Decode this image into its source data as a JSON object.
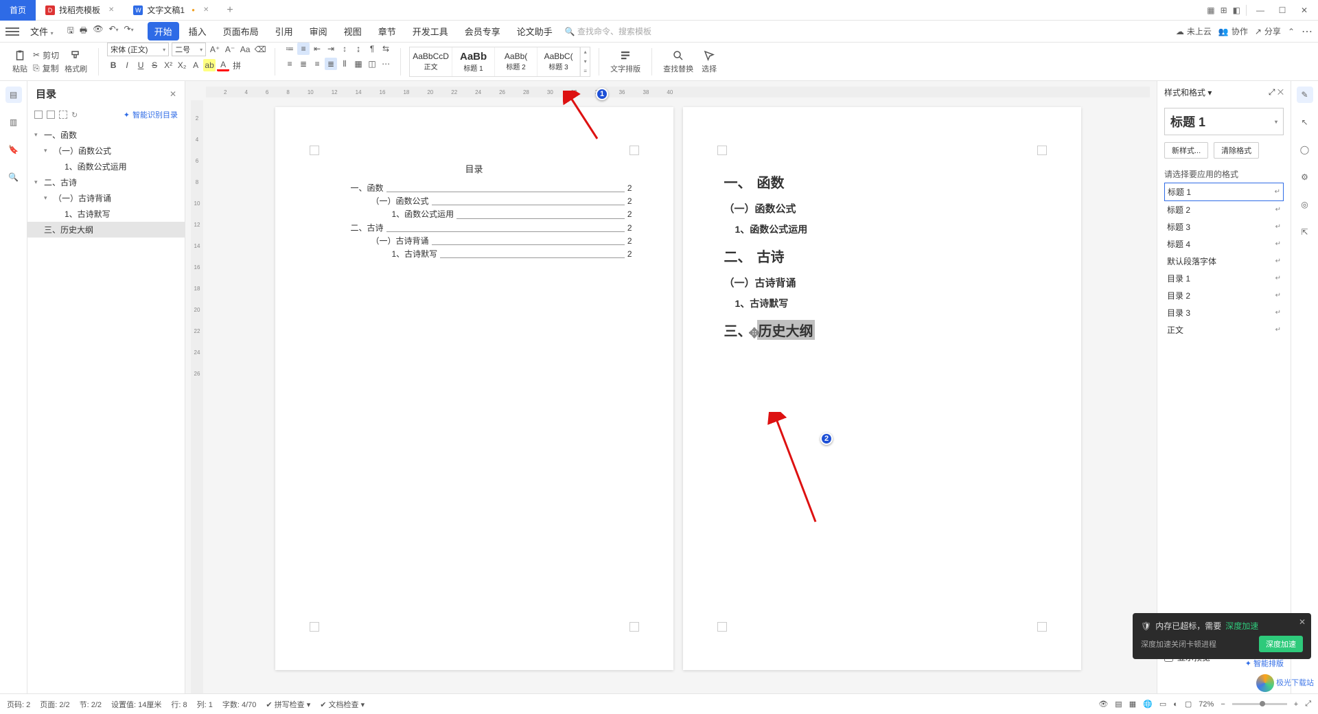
{
  "tabs": {
    "home": "首页",
    "template": "找稻壳模板",
    "doc": "文字文稿1"
  },
  "menubar": {
    "file": "文件",
    "tabs": [
      "开始",
      "插入",
      "页面布局",
      "引用",
      "审阅",
      "视图",
      "章节",
      "开发工具",
      "会员专享",
      "论文助手"
    ],
    "search_cmd": "查找命令、搜索模板",
    "cloud": "未上云",
    "coop": "协作",
    "share": "分享"
  },
  "ribbon": {
    "paste": "粘贴",
    "cut": "剪切",
    "copy": "复制",
    "format_painter": "格式刷",
    "font_name": "宋体 (正文)",
    "font_size": "二号",
    "styles": [
      {
        "preview": "AaBbCcD",
        "label": "正文"
      },
      {
        "preview": "AaBb",
        "label": "标题 1",
        "big": true
      },
      {
        "preview": "AaBb(",
        "label": "标题 2"
      },
      {
        "preview": "AaBbC(",
        "label": "标题 3"
      }
    ],
    "layout": "文字排版",
    "find_replace": "查找替换",
    "select": "选择"
  },
  "outline": {
    "title": "目录",
    "smart": "智能识别目录",
    "items": [
      {
        "level": 0,
        "caret": true,
        "text": "一、函数"
      },
      {
        "level": 1,
        "caret": true,
        "text": "（一）函数公式"
      },
      {
        "level": 2,
        "caret": false,
        "text": "1、函数公式运用"
      },
      {
        "level": 0,
        "caret": true,
        "text": "二、古诗"
      },
      {
        "level": 1,
        "caret": true,
        "text": "（一）古诗背诵"
      },
      {
        "level": 2,
        "caret": false,
        "text": "1、古诗默写"
      },
      {
        "level": 0,
        "caret": false,
        "text": "三、历史大纲",
        "selected": true
      }
    ]
  },
  "page1": {
    "toc_title": "目录",
    "toc": [
      {
        "level": 1,
        "label": "一、函数",
        "page": "2"
      },
      {
        "level": 2,
        "label": "（一）函数公式",
        "page": "2"
      },
      {
        "level": 3,
        "label": "1、函数公式运用",
        "page": "2"
      },
      {
        "level": 1,
        "label": "二、古诗",
        "page": "2"
      },
      {
        "level": 2,
        "label": "（一）古诗背诵",
        "page": "2"
      },
      {
        "level": 3,
        "label": "1、古诗默写",
        "page": "2"
      }
    ]
  },
  "page2": {
    "h1a_num": "一、",
    "h1a": "函数",
    "h2a": "（一）函数公式",
    "h3a": "1、函数公式运用",
    "h1b_num": "二、",
    "h1b": "古诗",
    "h2b": "（一）古诗背诵",
    "h3b": "1、古诗默写",
    "h1c_num": "三、",
    "h1c": "历史大纲"
  },
  "right_pane": {
    "title": "样式和格式",
    "current": "标题 1",
    "new_style": "新样式...",
    "clear": "清除格式",
    "choose": "请选择要应用的格式",
    "list": [
      "标题 1",
      "标题 2",
      "标题 3",
      "标题 4",
      "默认段落字体",
      "目录 1",
      "目录 2",
      "目录 3",
      "正文"
    ],
    "show_preview": "显示预览",
    "smart_layout": "智能排版"
  },
  "statusbar": {
    "page_no": "页码: 2",
    "page": "页面: 2/2",
    "section": "节: 2/2",
    "pos": "设置值: 14厘米",
    "line": "行: 8",
    "col": "列: 1",
    "words": "字数: 4/70",
    "spell": "拼写检查",
    "doc_check": "文档检查",
    "zoom": "72%"
  },
  "toast": {
    "title_a": "内存已超标，需要",
    "title_b": "深度加速",
    "body": "深度加速关闭卡顿进程",
    "btn": "深度加速"
  },
  "ruler_h": [
    "2",
    "4",
    "6",
    "8",
    "10",
    "12",
    "14",
    "16",
    "18",
    "20",
    "22",
    "24",
    "26",
    "28",
    "30",
    "32",
    "34",
    "36",
    "38",
    "40"
  ],
  "ruler_v": [
    "2",
    "4",
    "6",
    "8",
    "10",
    "12",
    "14",
    "16",
    "18",
    "20",
    "22",
    "24",
    "26"
  ],
  "watermark": "极光下载站"
}
